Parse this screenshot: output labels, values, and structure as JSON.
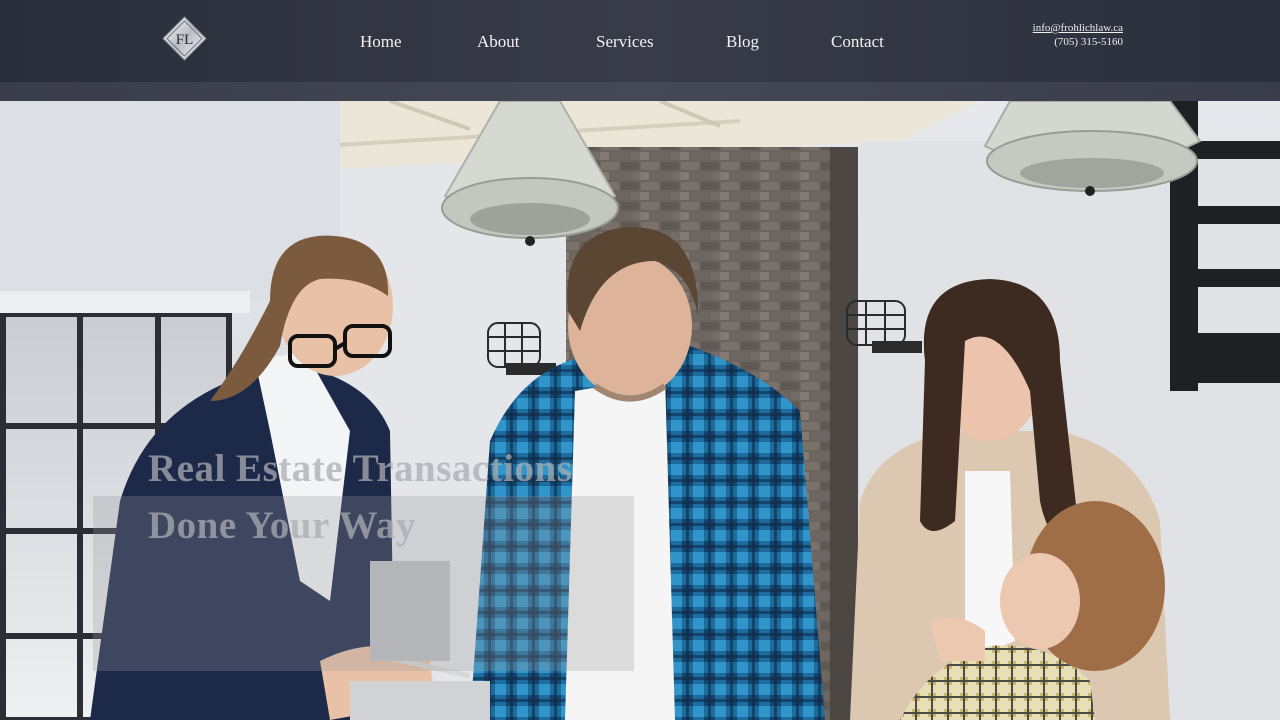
{
  "header": {
    "logo_letters": "FL",
    "nav": [
      {
        "label": "Home"
      },
      {
        "label": "About"
      },
      {
        "label": "Services"
      },
      {
        "label": "Blog"
      },
      {
        "label": "Contact"
      }
    ],
    "email": "info@frohlichlaw.ca",
    "phone": "(705) 315-5160"
  },
  "hero": {
    "title_line1": "Real Estate Transactions",
    "title_line2": "Done Your Way"
  },
  "colors": {
    "header_bg": "#2f323e",
    "nav_text": "#f2f2f2"
  }
}
